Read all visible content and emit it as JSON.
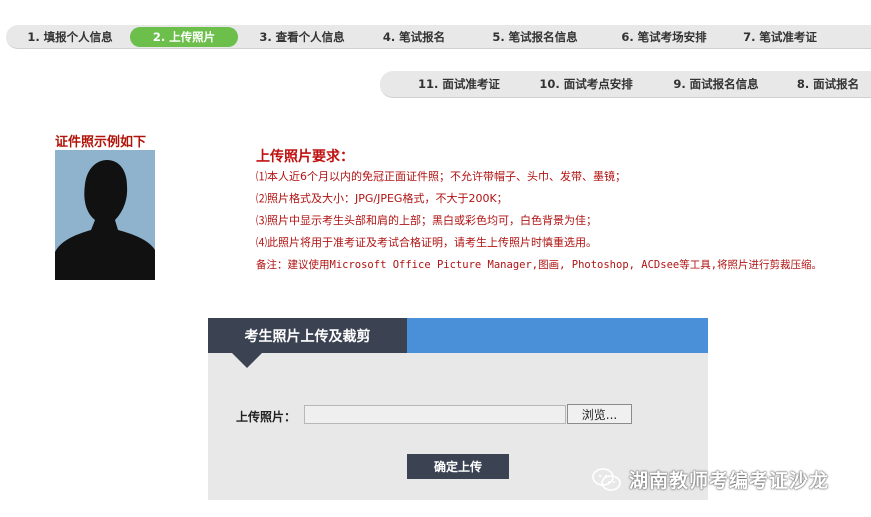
{
  "steps_row1": [
    {
      "label": "1. 填报个人信息",
      "active": false
    },
    {
      "label": "2. 上传照片",
      "active": true
    },
    {
      "label": "3. 查看个人信息",
      "active": false
    },
    {
      "label": "4. 笔试报名",
      "active": false
    },
    {
      "label": "5. 笔试报名信息",
      "active": false
    },
    {
      "label": "6. 笔试考场安排",
      "active": false
    },
    {
      "label": "7. 笔试准考证",
      "active": false
    }
  ],
  "steps_row2": [
    {
      "label": "11. 面试准考证"
    },
    {
      "label": "10. 面试考点安排"
    },
    {
      "label": "9. 面试报名信息"
    },
    {
      "label": "8. 面试报名"
    }
  ],
  "colors": {
    "active_step": "#6cbf4a",
    "accent_red": "#b01313",
    "panel_dark": "#3b4252",
    "panel_blue": "#4a90d9"
  },
  "sample": {
    "title": "证件照示例如下"
  },
  "requirements": {
    "title": "上传照片要求：",
    "lines": [
      "⑴本人近6个月以内的免冠正面证件照；不允许带帽子、头巾、发带、墨镜；",
      "⑵照片格式及大小：JPG/JPEG格式，不大于200K；",
      "⑶照片中显示考生头部和肩的上部；黑白或彩色均可，白色背景为佳；",
      "⑷此照片将用于准考证及考试合格证明，请考生上传照片时慎重选用。"
    ],
    "note": "备注：建议使用Microsoft Office Picture Manager,图画, Photoshop, ACDsee等工具,将照片进行剪裁压缩。"
  },
  "upload_panel": {
    "title": "考生照片上传及裁剪",
    "field_label": "上传照片：",
    "browse_label": "浏览...",
    "submit_label": "确定上传"
  },
  "watermark": {
    "text": "湖南教师考编考证沙龙",
    "icon": "wechat-icon"
  }
}
